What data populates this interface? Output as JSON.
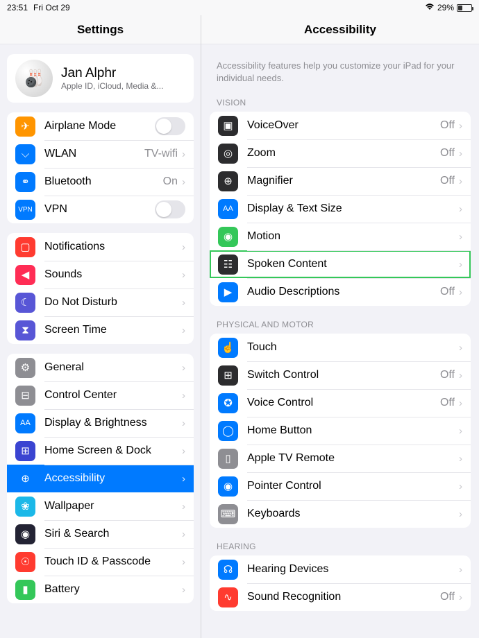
{
  "statusbar": {
    "time": "23:51",
    "date": "Fri Oct 29",
    "battery_pct": "29%"
  },
  "sidebar": {
    "title": "Settings",
    "profile": {
      "name": "Jan Alphr",
      "sub": "Apple ID, iCloud, Media &..."
    },
    "g1": [
      {
        "label": "Airplane Mode",
        "icon": "✈",
        "bg": "#ff9500",
        "toggle": true
      },
      {
        "label": "WLAN",
        "icon": "⌵",
        "bg": "#007aff",
        "value": "TV-wifi"
      },
      {
        "label": "Bluetooth",
        "icon": "⚭",
        "bg": "#007aff",
        "value": "On"
      },
      {
        "label": "VPN",
        "icon": "VPN",
        "bg": "#007aff",
        "toggle": true,
        "iconfs": "10px"
      }
    ],
    "g2": [
      {
        "label": "Notifications",
        "icon": "▢",
        "bg": "#ff3b30"
      },
      {
        "label": "Sounds",
        "icon": "◀",
        "bg": "#ff2d55"
      },
      {
        "label": "Do Not Disturb",
        "icon": "☾",
        "bg": "#5856d6"
      },
      {
        "label": "Screen Time",
        "icon": "⧗",
        "bg": "#5856d6"
      }
    ],
    "g3": [
      {
        "label": "General",
        "icon": "⚙",
        "bg": "#8e8e93"
      },
      {
        "label": "Control Center",
        "icon": "⊟",
        "bg": "#8e8e93"
      },
      {
        "label": "Display & Brightness",
        "icon": "AA",
        "bg": "#007aff",
        "iconfs": "11px"
      },
      {
        "label": "Home Screen & Dock",
        "icon": "⊞",
        "bg": "#3a44d1"
      },
      {
        "label": "Accessibility",
        "icon": "⊕",
        "bg": "#007aff",
        "selected": true
      },
      {
        "label": "Wallpaper",
        "icon": "❀",
        "bg": "#1bb8e8"
      },
      {
        "label": "Siri & Search",
        "icon": "◉",
        "bg": "#232334"
      },
      {
        "label": "Touch ID & Passcode",
        "icon": "☉",
        "bg": "#ff3b30"
      },
      {
        "label": "Battery",
        "icon": "▮",
        "bg": "#34c759"
      }
    ]
  },
  "detail": {
    "title": "Accessibility",
    "desc": "Accessibility features help you customize your iPad for your individual needs.",
    "sections": {
      "vision": {
        "header": "Vision",
        "items": [
          {
            "label": "VoiceOver",
            "icon": "▣",
            "bg": "#2c2c2e",
            "value": "Off"
          },
          {
            "label": "Zoom",
            "icon": "◎",
            "bg": "#2c2c2e",
            "value": "Off"
          },
          {
            "label": "Magnifier",
            "icon": "⊕",
            "bg": "#2c2c2e",
            "value": "Off"
          },
          {
            "label": "Display & Text Size",
            "icon": "AA",
            "bg": "#007aff",
            "iconfs": "11px"
          },
          {
            "label": "Motion",
            "icon": "◉",
            "bg": "#34c759"
          },
          {
            "label": "Spoken Content",
            "icon": "☷",
            "bg": "#2c2c2e",
            "highlight": true
          },
          {
            "label": "Audio Descriptions",
            "icon": "▶",
            "bg": "#007aff",
            "value": "Off"
          }
        ]
      },
      "physical": {
        "header": "Physical and Motor",
        "items": [
          {
            "label": "Touch",
            "icon": "☝",
            "bg": "#007aff"
          },
          {
            "label": "Switch Control",
            "icon": "⊞",
            "bg": "#2c2c2e",
            "value": "Off"
          },
          {
            "label": "Voice Control",
            "icon": "✪",
            "bg": "#007aff",
            "value": "Off"
          },
          {
            "label": "Home Button",
            "icon": "◯",
            "bg": "#007aff"
          },
          {
            "label": "Apple TV Remote",
            "icon": "▯",
            "bg": "#8e8e93"
          },
          {
            "label": "Pointer Control",
            "icon": "◉",
            "bg": "#007aff"
          },
          {
            "label": "Keyboards",
            "icon": "⌨",
            "bg": "#8e8e93"
          }
        ]
      },
      "hearing": {
        "header": "Hearing",
        "items": [
          {
            "label": "Hearing Devices",
            "icon": "☊",
            "bg": "#007aff"
          },
          {
            "label": "Sound Recognition",
            "icon": "∿",
            "bg": "#ff3b30",
            "value": "Off"
          }
        ]
      }
    }
  }
}
